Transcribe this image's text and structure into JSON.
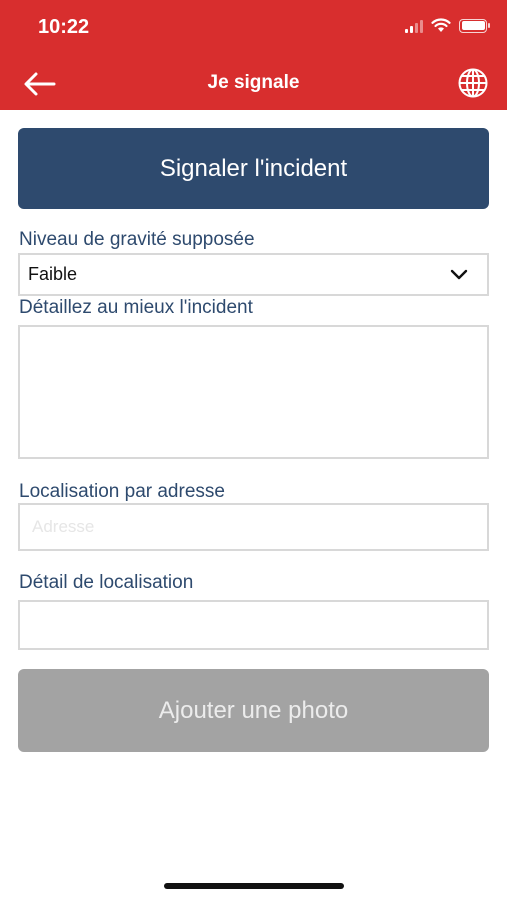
{
  "status_bar": {
    "time": "10:22"
  },
  "header": {
    "title": "Je signale",
    "back_icon": "back-arrow-icon",
    "language_icon": "globe-icon"
  },
  "form": {
    "report_button": "Signaler l'incident",
    "severity_label": "Niveau de gravité supposée",
    "severity_value": "Faible",
    "details_label": "Détaillez au mieux l'incident",
    "details_value": "",
    "address_label": "Localisation par adresse",
    "address_placeholder": "Adresse",
    "location_detail_label": "Détail de localisation",
    "location_detail_value": "",
    "add_photo_button": "Ajouter une photo"
  },
  "colors": {
    "header": "#d82e2e",
    "primary": "#2e4a6e",
    "disabled": "#a3a3a3"
  }
}
